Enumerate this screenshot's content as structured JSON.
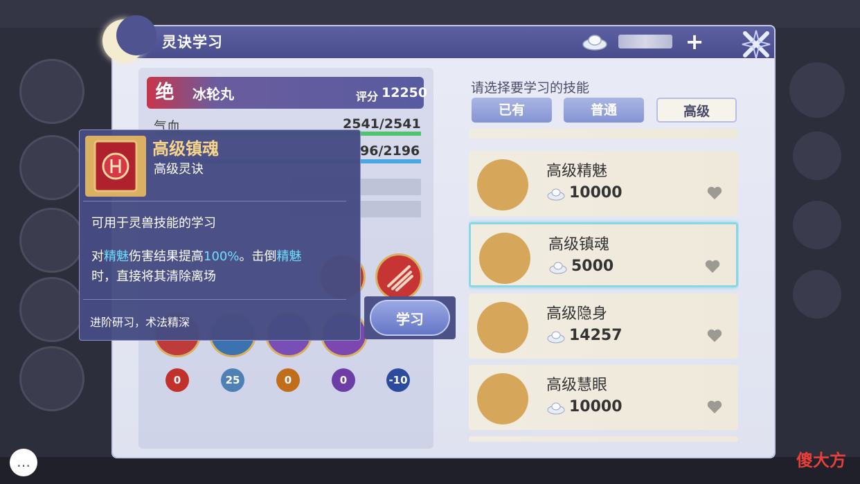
{
  "window": {
    "title": "灵诀学习",
    "currency_amount": ""
  },
  "pet": {
    "rank_badge": "绝",
    "name": "冰轮丸",
    "score_label": "评分",
    "score": "12250",
    "hp_label": "气血",
    "hp_value": "2541/2541",
    "mp_value": "96/2196"
  },
  "skill_dots": [
    {
      "value": "0",
      "color": "#c2302c"
    },
    {
      "value": "25",
      "color": "#4e7fb5"
    },
    {
      "value": "0",
      "color": "#c06d1c"
    },
    {
      "value": "0",
      "color": "#6d3fa6"
    },
    {
      "value": "-10",
      "color": "#2d4b9c"
    }
  ],
  "tooltip": {
    "title": "高级镇魂",
    "subtitle": "高级灵诀",
    "usage": "可用于灵兽技能的学习",
    "desc_prefix": "对",
    "desc_hl1": "精魅",
    "desc_mid": "伤害结果提高",
    "desc_hl2": "100%",
    "desc_mid2": "。击倒",
    "desc_hl3": "精魅",
    "desc_suffix": "时，直接将其清除离场",
    "footer": "进阶研习，术法精深"
  },
  "learn_button": "学习",
  "skill_select": {
    "prompt": "请选择要学习的技能",
    "tabs": [
      "已有",
      "普通",
      "高级"
    ],
    "active_tab": "高级",
    "items": [
      {
        "name": "高级精魅",
        "price": "10000",
        "selected": false
      },
      {
        "name": "高级镇魂",
        "price": "5000",
        "selected": true
      },
      {
        "name": "高级隐身",
        "price": "14257",
        "selected": false
      },
      {
        "name": "高级慧眼",
        "price": "10000",
        "selected": false
      }
    ]
  },
  "watermark": "傻大方",
  "colors": {
    "accent": "#4f5390",
    "highlight": "#6ddfff",
    "selected_border": "#89d6e6"
  }
}
